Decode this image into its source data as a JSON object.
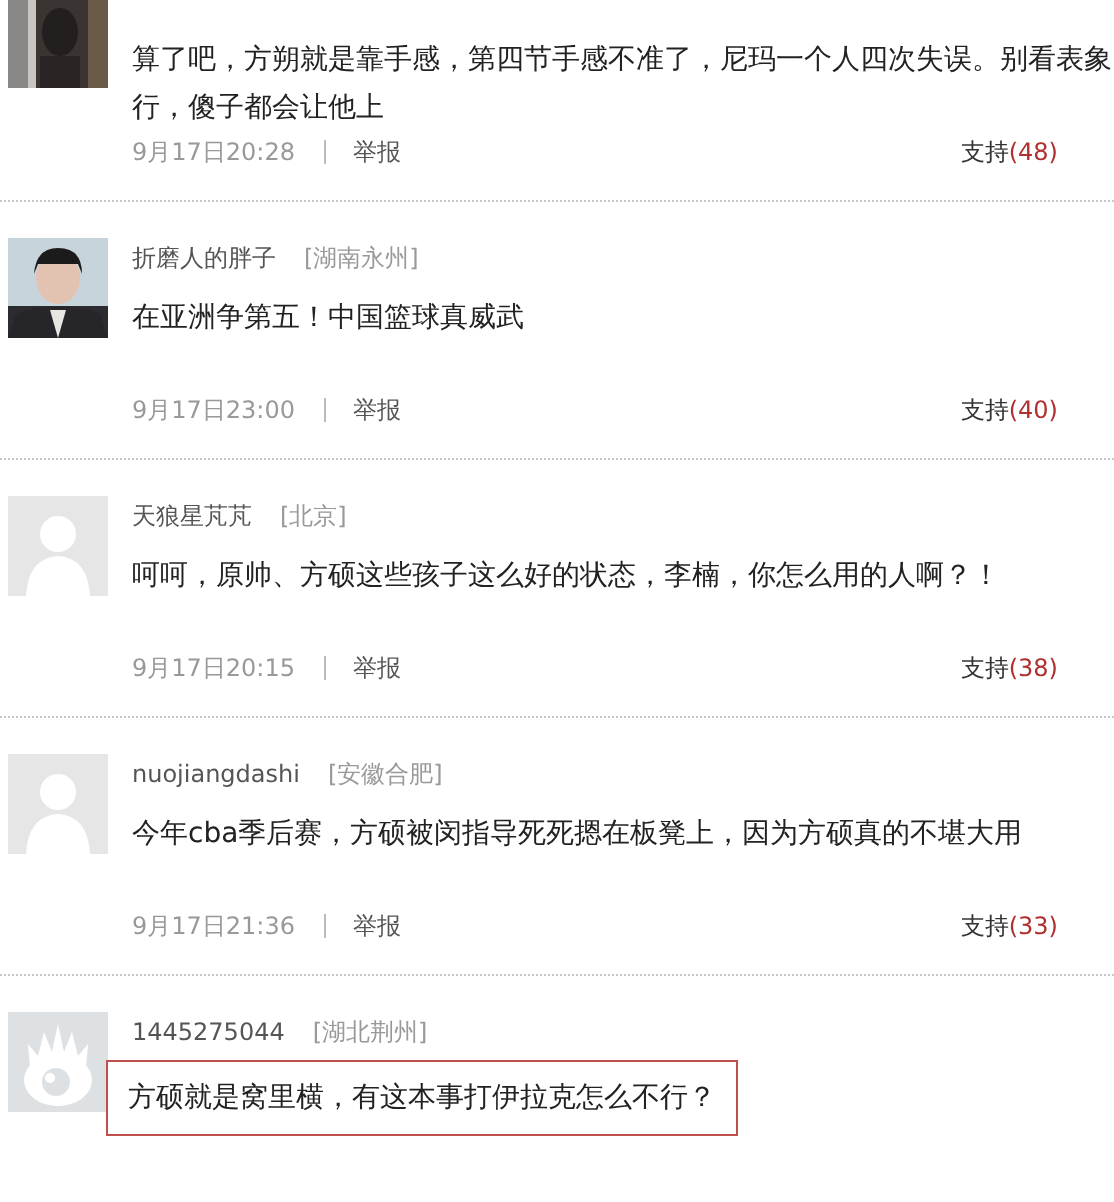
{
  "comments": [
    {
      "content": "算了吧，方朔就是靠手感，第四节手感不准了，尼玛一个人四次失误。别看表象行，傻子都会让他上",
      "time": "9月17日20:28",
      "report": "举报",
      "support": "支持",
      "count": "(48)",
      "highlighted": false
    },
    {
      "kind": "portrait",
      "user": "折磨人的胖子",
      "location": "[湖南永州]",
      "content": "在亚洲争第五！中国篮球真威武",
      "time": "9月17日23:00",
      "report": "举报",
      "support": "支持",
      "count": "(40)",
      "highlighted": false
    },
    {
      "kind": "default",
      "user": "天狼星芃芃",
      "location": "[北京]",
      "content": "呵呵，原帅、方硕这些孩子这么好的状态，李楠，你怎么用的人啊？！",
      "time": "9月17日20:15",
      "report": "举报",
      "support": "支持",
      "count": "(38)",
      "highlighted": false
    },
    {
      "kind": "default",
      "user": "nuojiangdashi",
      "location": "[安徽合肥]",
      "content": "今年cba季后赛，方硕被闵指导死死摁在板凳上，因为方硕真的不堪大用",
      "time": "9月17日21:36",
      "report": "举报",
      "support": "支持",
      "count": "(33)",
      "highlighted": false
    },
    {
      "kind": "logo",
      "user": "1445275044",
      "location": "[湖北荆州]",
      "content": "方硕就是窝里横，有这本事打伊拉克怎么不行？",
      "highlighted": true
    }
  ]
}
